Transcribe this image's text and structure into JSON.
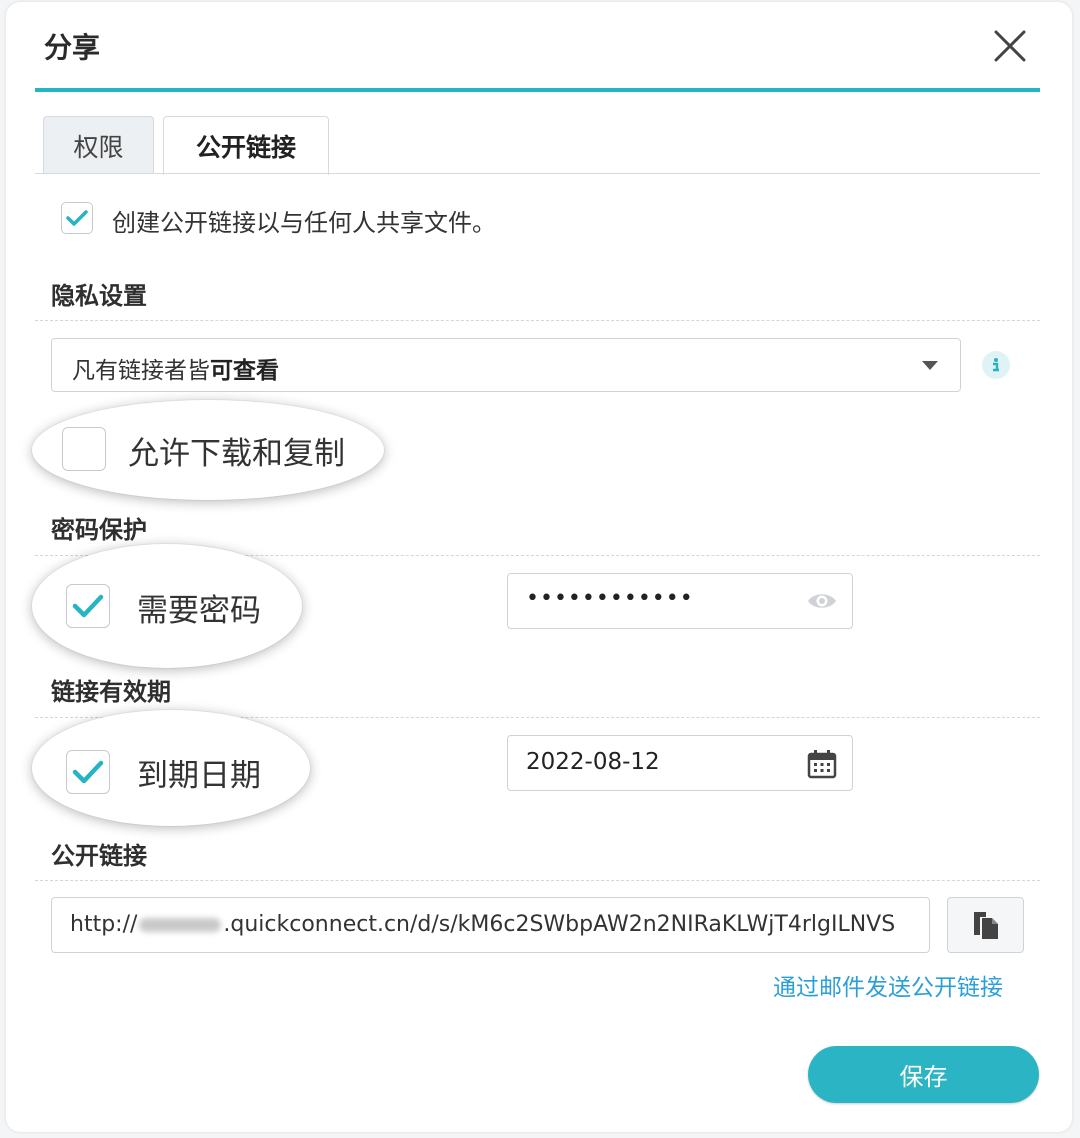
{
  "dialog": {
    "title": "分享",
    "close_icon": "close-icon"
  },
  "tabs": [
    {
      "label": "权限",
      "active": false
    },
    {
      "label": "公开链接",
      "active": true
    }
  ],
  "create_link": {
    "label": "创建公开链接以与任何人共享文件。",
    "checked": true
  },
  "privacy": {
    "section_title": "隐私设置",
    "select_prefix": "凡有链接者皆",
    "select_bold": "可查看",
    "info_icon": "info-icon",
    "allow_download": {
      "label": "允许下载和复制",
      "checked": false
    }
  },
  "password": {
    "section_title": "密码保护",
    "require": {
      "label": "需要密码",
      "checked": true
    },
    "value": "••••••••••••",
    "eye_icon": "eye-icon"
  },
  "expiry": {
    "section_title": "链接有效期",
    "enable": {
      "label": "到期日期",
      "checked": true
    },
    "date": "2022-08-12",
    "calendar_icon": "calendar-icon"
  },
  "public_link": {
    "section_title": "公开链接",
    "url_prefix": "http://",
    "url_suffix": ".quickconnect.cn/d/s/kM6c2SWbpAW2n2NIRaKLWjT4rlgILNVS",
    "copy_icon": "copy-icon",
    "email_link": "通过邮件发送公开链接"
  },
  "footer": {
    "save_label": "保存"
  },
  "colors": {
    "accent": "#27b4c2",
    "link": "#2a9fd8",
    "check": "#27b4c2"
  }
}
